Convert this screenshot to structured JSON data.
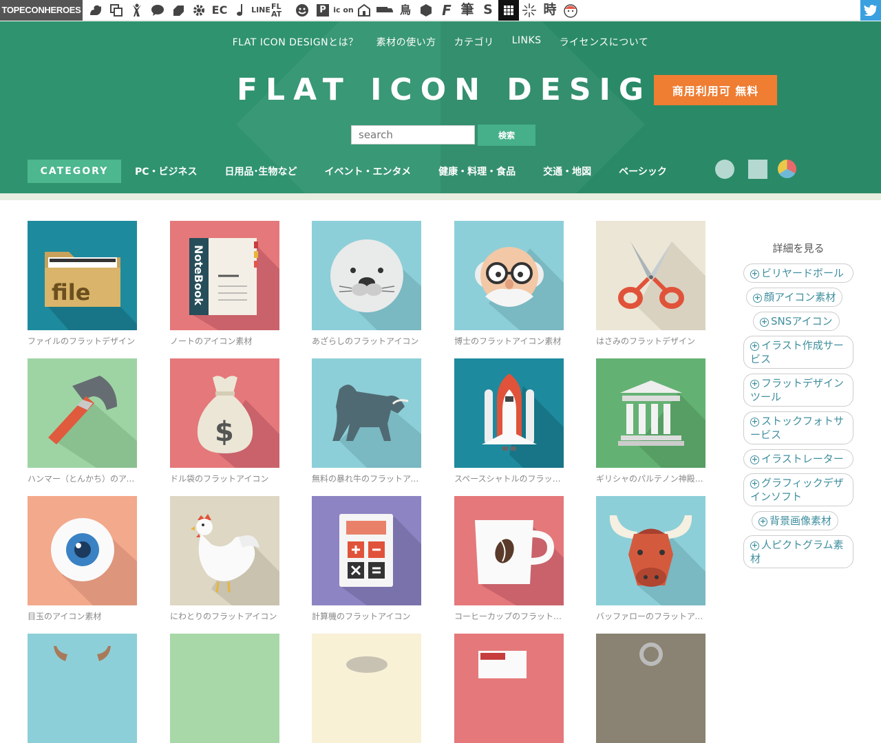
{
  "topbar": {
    "brand": "TOPECONHEROES",
    "icons": [
      "squirrel-icon",
      "copy-icon",
      "dancer-icon",
      "chat-icon",
      "tag-icon",
      "gear-icon",
      "ec-icon",
      "note-icon",
      "line-icon",
      "flat-icon",
      "smile-icon",
      "p-icon",
      "icon-icon",
      "house-icon",
      "truck-icon",
      "bird-icon",
      "hex-icon",
      "f-icon",
      "brush-icon",
      "s-icon",
      "grid-icon",
      "burst-icon",
      "time-icon",
      "face-icon"
    ],
    "ec_text": "EC",
    "line_text": "LINE",
    "flat_text": "FL AT",
    "p_text": "P",
    "icon_text": "ic on",
    "bird_text": "鳥",
    "f_text": "F",
    "brush_text": "筆",
    "s_text": "S",
    "time_text": "時"
  },
  "header": {
    "nav": [
      "FLAT ICON DESIGNとは？",
      "素材の使い方",
      "カテゴリ",
      "LINKS",
      "ライセンスについて"
    ],
    "logo": "FLAT ICON DESIGN",
    "badge": "商用利用可 無料",
    "search_placeholder": "search",
    "search_button": "検索",
    "category_label": "CATEGORY",
    "categories": [
      "PC・ビジネス",
      "日用品･生物など",
      "イベント・エンタメ",
      "健康・料理・食品",
      "交通・地図",
      "ベーシック"
    ]
  },
  "colors": {
    "header_green": "#2d8f6b",
    "accent_orange": "#ef7d32",
    "category_green": "#4db78f",
    "tag_text": "#3e8e9e"
  },
  "cards": [
    {
      "caption": "ファイルのフラットデザイン",
      "icon": "file-folder-icon",
      "bg": "#1e8a9e"
    },
    {
      "caption": "ノートのアイコン素材",
      "icon": "notebook-icon",
      "bg": "#e5787a"
    },
    {
      "caption": "あざらしのフラットアイコン",
      "icon": "seal-icon",
      "bg": "#8dcfd8"
    },
    {
      "caption": "博士のフラットアイコン素材",
      "icon": "professor-icon",
      "bg": "#8dcfd8"
    },
    {
      "caption": "はさみのフラットデザイン",
      "icon": "scissors-icon",
      "bg": "#ece6d6"
    },
    {
      "caption": "ハンマー（とんかち）のアイコン",
      "icon": "hammer-icon",
      "bg": "#9ed4a4"
    },
    {
      "caption": "ドル袋のフラットアイコン",
      "icon": "money-bag-icon",
      "bg": "#e5787a"
    },
    {
      "caption": "無料の暴れ牛のフラットアイコン",
      "icon": "bull-icon",
      "bg": "#8dcfd8"
    },
    {
      "caption": "スペースシャトルのフラットデザイン",
      "icon": "space-shuttle-icon",
      "bg": "#1e8a9e"
    },
    {
      "caption": "ギリシャのパルテノン神殿のアイコン",
      "icon": "parthenon-icon",
      "bg": "#64b273"
    },
    {
      "caption": "目玉のアイコン素材",
      "icon": "eyeball-icon",
      "bg": "#f3a98c"
    },
    {
      "caption": "にわとりのフラットアイコン",
      "icon": "chicken-icon",
      "bg": "#ddd7c3"
    },
    {
      "caption": "計算機のフラットアイコン",
      "icon": "calculator-icon",
      "bg": "#8c84c3"
    },
    {
      "caption": "コーヒーカップのフラットアイコン",
      "icon": "coffee-cup-icon",
      "bg": "#e5787a"
    },
    {
      "caption": "バッファローのフラットアイコン",
      "icon": "buffalo-icon",
      "bg": "#8dcfd8"
    },
    {
      "caption": "",
      "icon": "horns-icon",
      "bg": "#8dcfd8"
    },
    {
      "caption": "",
      "icon": "partial-icon",
      "bg": "#a8d8a8"
    },
    {
      "caption": "",
      "icon": "partial-icon",
      "bg": "#f8f1d6"
    },
    {
      "caption": "",
      "icon": "partial-icon",
      "bg": "#e5787a"
    },
    {
      "caption": "",
      "icon": "partial-icon",
      "bg": "#8a8272"
    }
  ],
  "sidebar": {
    "title": "詳細を見る",
    "tags": [
      "ビリヤードボール",
      "顔アイコン素材",
      "SNSアイコン",
      "イラスト作成サービス",
      "フラットデザインツール",
      "ストックフォトサービス",
      "イラストレーター",
      "グラフィックデザインソフト",
      "背景画像素材",
      "人ピクトグラム素材"
    ]
  }
}
